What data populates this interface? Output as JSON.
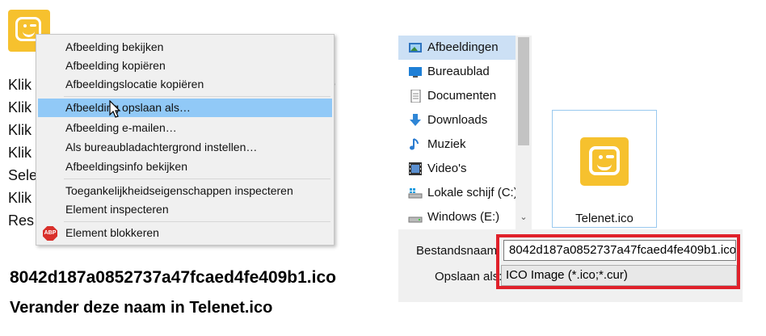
{
  "background_text": {
    "lines": [
      "Klik",
      "Klik",
      "Klik",
      "Klik",
      "Sele",
      "Klik",
      "Res"
    ],
    "right_fragments": [
      "e",
      "y"
    ]
  },
  "context_menu": {
    "items": [
      "Afbeelding bekijken",
      "Afbeelding kopiëren",
      "Afbeeldingslocatie kopiëren",
      "Afbeelding opslaan als…",
      "Afbeelding e-mailen…",
      "Als bureaubladachtergrond instellen…",
      "Afbeeldingsinfo bekijken",
      "Toegankelijkheidseigenschappen inspecteren",
      "Element inspecteren",
      "Element blokkeren"
    ],
    "highlighted_index": 3,
    "abp_label": "ABP"
  },
  "captions": {
    "filename": "8042d187a0852737a47fcaed4fe409b1.ico",
    "instruction": "Verander deze naam in Telenet.ico"
  },
  "dialog": {
    "nav_items": [
      {
        "label": "Afbeeldingen",
        "icon": "pictures-icon"
      },
      {
        "label": "Bureaublad",
        "icon": "desktop-icon"
      },
      {
        "label": "Documenten",
        "icon": "documents-icon"
      },
      {
        "label": "Downloads",
        "icon": "downloads-icon"
      },
      {
        "label": "Muziek",
        "icon": "music-icon"
      },
      {
        "label": "Video's",
        "icon": "video-icon"
      },
      {
        "label": "Lokale schijf (C:)",
        "icon": "drive-c-icon"
      },
      {
        "label": "Windows (E:)",
        "icon": "drive-e-icon"
      }
    ],
    "file_tile_name": "Telenet.ico",
    "filename_label": "Bestandsnaam:",
    "filename_value": "8042d187a0852737a47fcaed4fe409b1.ico",
    "savetype_label": "Opslaan als:",
    "savetype_value": "ICO Image (*.ico;*.cur)"
  },
  "colors": {
    "highlight": "#91c9f7",
    "nav_selected": "#cce0f5",
    "telenet_yellow": "#f6c12e",
    "red_outline": "#e0202a"
  }
}
